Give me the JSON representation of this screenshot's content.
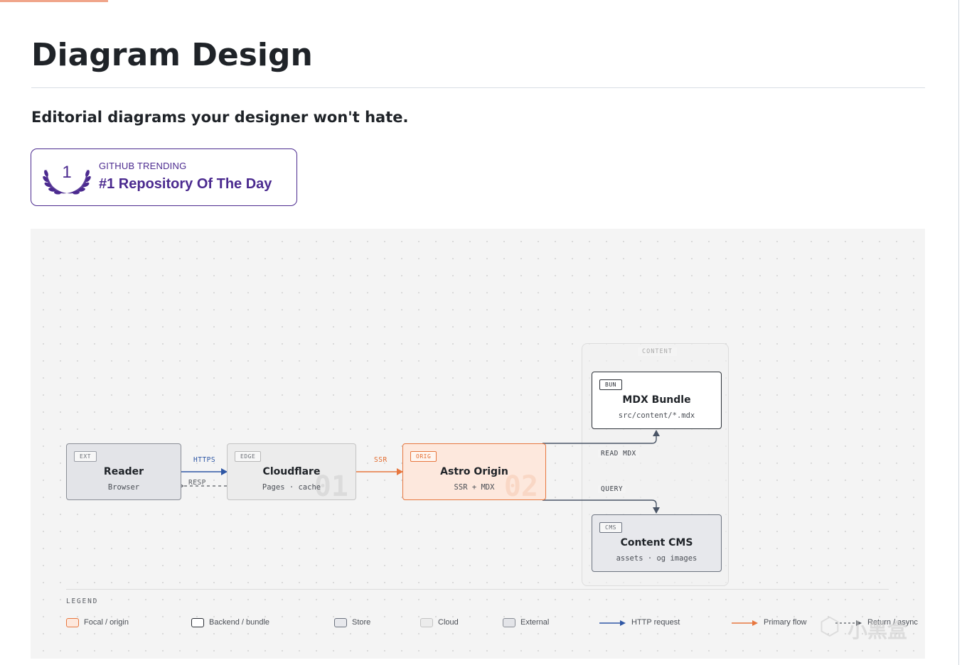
{
  "page": {
    "title": "Diagram Design",
    "tagline": "Editorial diagrams your designer won't hate."
  },
  "badge": {
    "rank": "1",
    "kicker": "GITHUB TRENDING",
    "headline": "#1 Repository Of The Day",
    "color": "#4b2a8f"
  },
  "diagram": {
    "group_label": "CONTENT",
    "nodes": {
      "reader": {
        "tag": "EXT",
        "name": "Reader",
        "sub": "Browser"
      },
      "cloudflare": {
        "tag": "EDGE",
        "name": "Cloudflare",
        "sub": "Pages · cache",
        "number": "01"
      },
      "astro": {
        "tag": "ORIG",
        "name": "Astro Origin",
        "sub": "SSR + MDX",
        "number": "02"
      },
      "mdx": {
        "tag": "BUN",
        "name": "MDX Bundle",
        "sub": "src/content/*.mdx"
      },
      "cms": {
        "tag": "CMS",
        "name": "Content CMS",
        "sub": "assets · og images"
      }
    },
    "edges": {
      "https": "HTTPS",
      "resp": "RESP",
      "ssr": "SSR",
      "read": "READ MDX",
      "query": "QUERY"
    },
    "colors": {
      "http": "#2f57a5",
      "primary": "#e7773f",
      "neutral": "#4a5566"
    }
  },
  "legend": {
    "title": "LEGEND",
    "items": [
      {
        "label": "Focal / origin"
      },
      {
        "label": "Backend / bundle"
      },
      {
        "label": "Store"
      },
      {
        "label": "Cloud"
      },
      {
        "label": "External"
      },
      {
        "label": "HTTP request"
      },
      {
        "label": "Primary flow"
      },
      {
        "label": "Return / async"
      }
    ]
  },
  "watermark": {
    "text": "小黑盒"
  }
}
